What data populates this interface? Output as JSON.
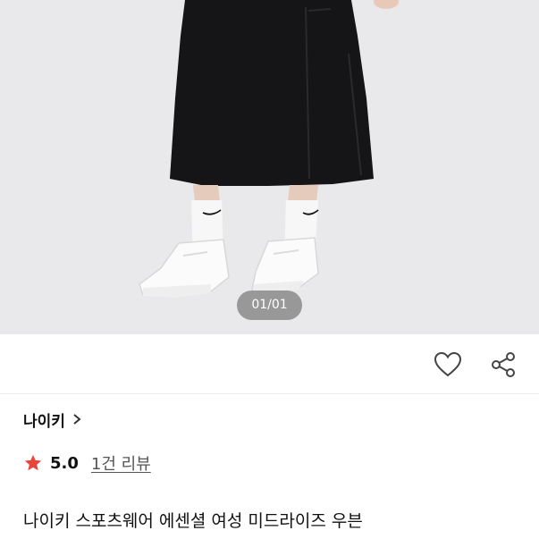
{
  "product_image": {
    "description_icon": "product-photo",
    "page_indicator": "01/01"
  },
  "actions": {
    "like_icon": "heart-icon",
    "share_icon": "share-icon"
  },
  "brand": {
    "name": "나이키",
    "chevron": "›"
  },
  "rating": {
    "star_color": "#e8453c",
    "score": "5.0",
    "reviews_label": "1건 리뷰"
  },
  "product": {
    "title": "나이키 스포츠웨어 에센셜 여성 미드라이즈 우븐"
  }
}
